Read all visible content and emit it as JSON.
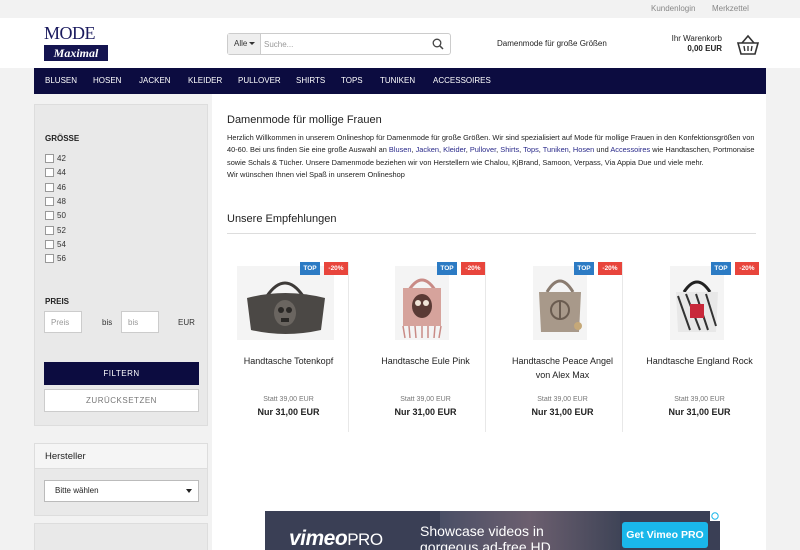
{
  "topbar": {
    "login": "Kundenlogin",
    "wishlist": "Merkzettel"
  },
  "logo": {
    "line1": "MODE",
    "line2": "Maximal"
  },
  "search": {
    "category": "Alle",
    "placeholder": "Suche...",
    "icon": "search-icon"
  },
  "tagline": "Damenmode für große Größen",
  "cart": {
    "label": "Ihr Warenkorb",
    "total": "0,00 EUR",
    "icon": "basket-icon"
  },
  "nav": [
    "Blusen",
    "Hosen",
    "Jacken",
    "Kleider",
    "Pullover",
    "Shirts",
    "Tops",
    "Tuniken",
    "Accessoires"
  ],
  "filters": {
    "size_heading": "GRÖSSE",
    "sizes": [
      "42",
      "44",
      "46",
      "48",
      "50",
      "52",
      "54",
      "56"
    ],
    "price_heading": "PREIS",
    "price_from_placeholder": "Preis",
    "price_to_placeholder": "bis",
    "between": "bis",
    "currency": "EUR",
    "filter_button": "Filtern",
    "reset_button": "Zurücksetzen"
  },
  "manufacturer": {
    "title": "Hersteller",
    "select_value": "Bitte wählen"
  },
  "main": {
    "title": "Damenmode für mollige Frauen",
    "intro": {
      "p1": "Herzlich Willkommen in unserem Onlineshop für Damenmode für große Größen. Wir sind spezialisiert auf Mode für mollige Frauen in den Konfektionsgrößen von 40-60. Bei uns finden Sie eine große Auswahl an ",
      "links": [
        "Blusen",
        "Jacken",
        "Kleider",
        "Pullover",
        "Shirts",
        "Tops",
        "Tuniken",
        "Hosen",
        "Accessoires"
      ],
      "p2": " wie Handtaschen, Portmonaise sowie Schals & Tücher. Unsere Damenmode beziehen wir von Herstellern wie Chalou, KjBrand, Samoon, Verpass, Via Appia Due und viele mehr.",
      "p3": "Wir wünschen Ihnen viel Spaß in unserem Onlineshop",
      "and": "und"
    },
    "recommendations_title": "Unsere Empfehlungen"
  },
  "products": [
    {
      "name": "Handtasche Totenkopf",
      "badge_top": "TOP",
      "badge_sale": "-20%",
      "old_price": "Statt 39,00 EUR",
      "price": "Nur 31,00 EUR"
    },
    {
      "name": "Handtasche Eule Pink",
      "badge_top": "TOP",
      "badge_sale": "-20%",
      "old_price": "Statt 39,00 EUR",
      "price": "Nur 31,00 EUR"
    },
    {
      "name": "Handtasche Peace Angel von Alex Max",
      "badge_top": "TOP",
      "badge_sale": "-20%",
      "old_price": "Statt 39,00 EUR",
      "price": "Nur 31,00 EUR"
    },
    {
      "name": "Handtasche England Rock",
      "badge_top": "TOP",
      "badge_sale": "-20%",
      "old_price": "Statt 39,00 EUR",
      "price": "Nur 31,00 EUR"
    }
  ],
  "ad": {
    "brand": "vimeo",
    "brand_suffix": "PRO",
    "copy_line1": "Showcase videos in",
    "copy_line2": "gorgeous ad-free HD",
    "cta": "Get Vimeo PRO"
  }
}
